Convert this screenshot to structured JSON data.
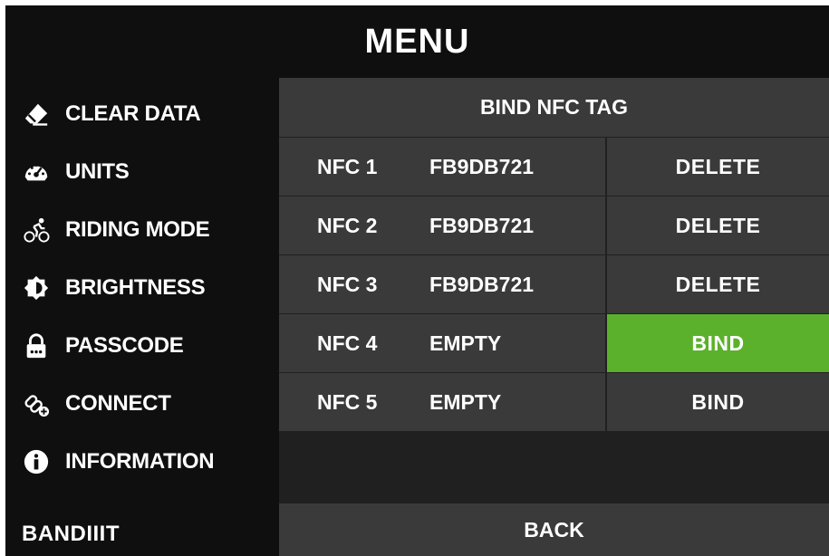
{
  "header": {
    "title": "MENU"
  },
  "sidebar": {
    "items": [
      {
        "label": "CLEAR DATA",
        "icon": "eraser-icon"
      },
      {
        "label": "UNITS",
        "icon": "speedometer-icon"
      },
      {
        "label": "RIDING MODE",
        "icon": "cyclist-icon"
      },
      {
        "label": "BRIGHTNESS",
        "icon": "brightness-icon"
      },
      {
        "label": "PASSCODE",
        "icon": "lock-icon"
      },
      {
        "label": "CONNECT",
        "icon": "link-plus-icon"
      },
      {
        "label": "INFORMATION",
        "icon": "info-icon"
      }
    ],
    "logo": "BANDIIIT"
  },
  "panel": {
    "title": "BIND NFC TAG",
    "rows": [
      {
        "name": "NFC 1",
        "tag": "FB9DB721",
        "action": "DELETE",
        "active": false
      },
      {
        "name": "NFC 2",
        "tag": "FB9DB721",
        "action": "DELETE",
        "active": false
      },
      {
        "name": "NFC 3",
        "tag": "FB9DB721",
        "action": "DELETE",
        "active": false
      },
      {
        "name": "NFC 4",
        "tag": "EMPTY",
        "action": "BIND",
        "active": true
      },
      {
        "name": "NFC 5",
        "tag": "EMPTY",
        "action": "BIND",
        "active": false
      }
    ],
    "back_label": "BACK"
  },
  "colors": {
    "background": "#0f0f10",
    "panel": "#3a3a3a",
    "accent": "#5bb12b"
  }
}
